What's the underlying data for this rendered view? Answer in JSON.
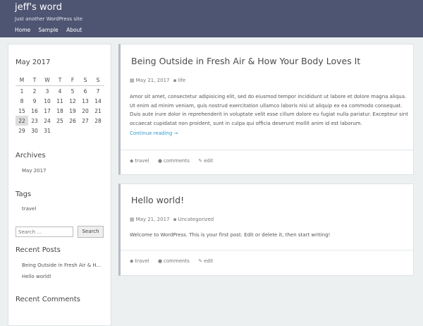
{
  "header": {
    "site_title": "jeff's word",
    "tagline": "Just another WordPress site",
    "nav": [
      "Home",
      "Sample",
      "About"
    ]
  },
  "calendar": {
    "title": "May 2017",
    "weekdays": [
      "M",
      "T",
      "W",
      "T",
      "F",
      "S",
      "S"
    ],
    "weeks": [
      [
        "1",
        "2",
        "3",
        "4",
        "5",
        "6",
        "7"
      ],
      [
        "8",
        "9",
        "10",
        "11",
        "12",
        "13",
        "14"
      ],
      [
        "15",
        "16",
        "17",
        "18",
        "19",
        "20",
        "21"
      ],
      [
        "22",
        "23",
        "24",
        "25",
        "26",
        "27",
        "28"
      ],
      [
        "29",
        "30",
        "31",
        "",
        "",
        "",
        ""
      ]
    ],
    "today": "22"
  },
  "archives": {
    "title": "Archives",
    "items": [
      "May 2017"
    ]
  },
  "tags": {
    "title": "Tags",
    "items": [
      "travel"
    ]
  },
  "search": {
    "placeholder": "Search ...",
    "button": "Search"
  },
  "recent_posts": {
    "title": "Recent Posts",
    "items": [
      "Being Outside in Fresh Air & H...",
      "Hello world!"
    ]
  },
  "recent_comments": {
    "title": "Recent Comments"
  },
  "posts": [
    {
      "title": "Being Outside in Fresh Air & How Your Body Loves It",
      "date": "May 21, 2017",
      "category": "life",
      "body": "Amor sit amet, consectetur adipisicing elit, sed do eiusmod tempor incididunt ut labore et dolore magna aliqua. Ut enim ad minim veniam, quis nostrud exercitation ullamco laboris nisi ut aliquip ex ea commodo consequat. Duis aute irure dolor in reprehenderit in voluptate velit esse cillum dolore eu fugiat nulla pariatur. Excepteur sint occaecat cupidatat non proident, sunt in culpa qui officia deserunt mollit anim id est laborum.",
      "read_more": "Continue reading →",
      "tag": "travel",
      "comments": "comments",
      "edit": "edit"
    },
    {
      "title": "Hello world!",
      "date": "May 21, 2017",
      "category": "Uncategorized",
      "body": "Welcome to WordPress. This is your first post. Edit or delete it, then start writing!",
      "tag": "travel",
      "comments": "comments",
      "edit": "edit"
    }
  ],
  "colors": {
    "header_bg": "#4e5572",
    "link": "#3399cc",
    "page_bg": "#ecf0f1"
  }
}
